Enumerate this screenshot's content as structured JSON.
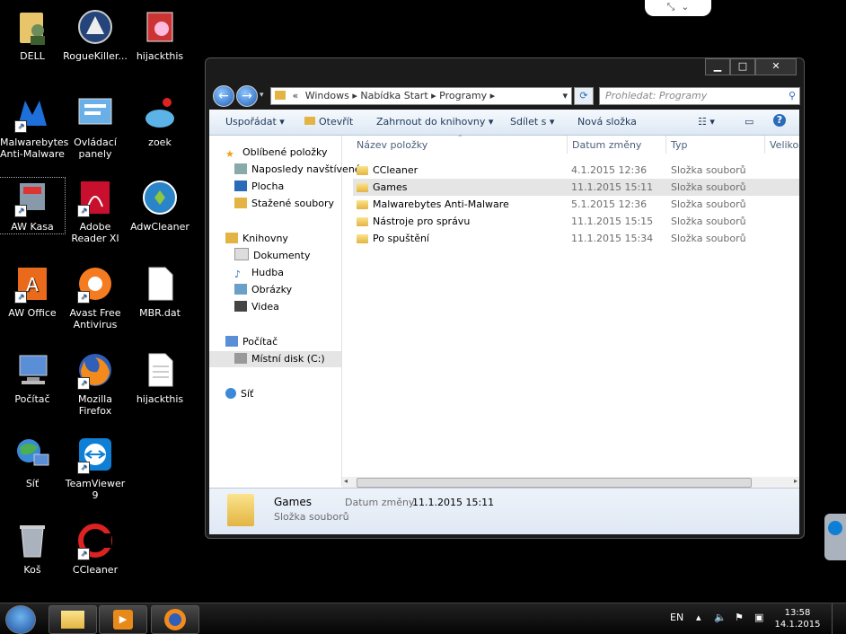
{
  "desktop": {
    "icons": [
      {
        "label": "DELL",
        "icon": "user-folder-icon"
      },
      {
        "label": "RogueKiller...",
        "icon": "roguekiller-shield-icon"
      },
      {
        "label": "hijackthis",
        "icon": "hijackthis-icon"
      },
      {
        "label": "Malwarebytes Anti-Malware",
        "icon": "malwarebytes-icon"
      },
      {
        "label": "Ovládací panely",
        "icon": "control-panel-icon"
      },
      {
        "label": "zoek",
        "icon": "zoek-icon"
      },
      {
        "label": "AW Kasa",
        "icon": "aw-kasa-icon"
      },
      {
        "label": "Adobe Reader XI",
        "icon": "adobe-reader-icon"
      },
      {
        "label": "AdwCleaner",
        "icon": "adwcleaner-icon"
      },
      {
        "label": "AW Office",
        "icon": "aw-office-icon"
      },
      {
        "label": "Avast Free Antivirus",
        "icon": "avast-icon"
      },
      {
        "label": "MBR.dat",
        "icon": "file-icon"
      },
      {
        "label": "Počítač",
        "icon": "computer-icon"
      },
      {
        "label": "Mozilla Firefox",
        "icon": "firefox-icon"
      },
      {
        "label": "hijackthis",
        "icon": "text-file-icon"
      },
      {
        "label": "Síť",
        "icon": "network-icon"
      },
      {
        "label": "TeamViewer 9",
        "icon": "teamviewer-icon"
      },
      {
        "label": "Koš",
        "icon": "recycle-bin-icon"
      },
      {
        "label": "CCleaner",
        "icon": "ccleaner-icon"
      }
    ]
  },
  "explorer": {
    "address": {
      "prefix": "«",
      "parts": [
        "Windows",
        "Nabídka Start",
        "Programy"
      ]
    },
    "search_placeholder": "Prohledat: Programy",
    "toolbar": {
      "organize": "Uspořádat",
      "open": "Otevřít",
      "include": "Zahrnout do knihovny",
      "share": "Sdílet s",
      "new_folder": "Nová složka"
    },
    "nav": {
      "favorites": "Oblíbené položky",
      "recent": "Naposledy navštívené",
      "desktop": "Plocha",
      "downloads": "Stažené soubory",
      "libraries": "Knihovny",
      "documents": "Dokumenty",
      "music": "Hudba",
      "pictures": "Obrázky",
      "videos": "Videa",
      "computer": "Počítač",
      "local_disk": "Místní disk (C:)",
      "network": "Síť"
    },
    "columns": {
      "name": "Název položky",
      "date": "Datum změny",
      "type": "Typ",
      "size": "Velikost"
    },
    "rows": [
      {
        "name": "CCleaner",
        "date": "4.1.2015 12:36",
        "type": "Složka souborů"
      },
      {
        "name": "Games",
        "date": "11.1.2015 15:11",
        "type": "Složka souborů"
      },
      {
        "name": "Malwarebytes Anti-Malware",
        "date": "5.1.2015 12:36",
        "type": "Složka souborů"
      },
      {
        "name": "Nástroje pro správu",
        "date": "11.1.2015 15:15",
        "type": "Složka souborů"
      },
      {
        "name": "Po spuštění",
        "date": "11.1.2015 15:34",
        "type": "Složka souborů"
      }
    ],
    "details": {
      "name": "Games",
      "type": "Složka souborů",
      "date_label": "Datum změny:",
      "date_value": "11.1.2015 15:11"
    }
  },
  "taskbar": {
    "language": "EN",
    "time": "13:58",
    "date": "14.1.2015"
  }
}
